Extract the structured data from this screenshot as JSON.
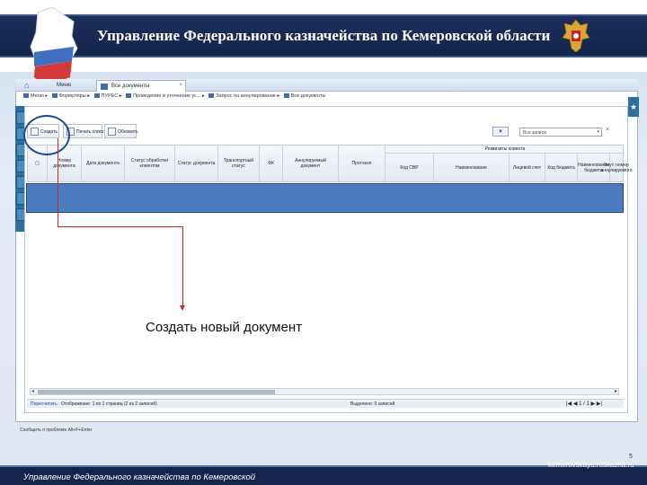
{
  "banner": {
    "title": "Управление Федерального казначейства по Кемеровской области"
  },
  "app": {
    "tabs": {
      "home_icon": "home-icon",
      "menu": "Меню",
      "active": "Все документы",
      "close": "×"
    },
    "breadcrumbs": [
      "Меню",
      "Формуляры",
      "ПУРЕС",
      "Проведение и уточнение ус...",
      "Запрос на аннулирование",
      "Все документы"
    ],
    "toolbar": {
      "create": "Создать",
      "print_list": "Печать списка",
      "refresh": "Обновить"
    },
    "filter": {
      "select_value": "Все записи",
      "dropdown": "▾",
      "clear": "×"
    },
    "grid": {
      "group_header": "Реквизиты клиента",
      "columns": [
        "Номер документа",
        "Дата документа",
        "Статус обработки клиентом",
        "Статус документа",
        "Транспортный статус",
        "ФК",
        "Аннулируемый документ",
        "Протокол"
      ],
      "sub_columns": [
        "Код СВР",
        "Наименование",
        "Лицевой счет",
        "Код бюджета",
        "Наименование бюджета",
        "Внут. номер аннулируемого"
      ]
    },
    "statusbar": {
      "recalc": "Пересчитать",
      "display": "Отображение: 1 по 1 страниц (2 из 2 записей)",
      "selected": "Выделено: 0 записей",
      "pager": "|◀ ◀ 1 / 1 ▶ ▶|"
    },
    "bottom_link": "Сообщить о проблеме Alt+F+Enter",
    "rail_right": "★"
  },
  "annotation": {
    "text": "Создать новый документ"
  },
  "footer": {
    "left": "Управление Федерального казначейства по Кемеровской",
    "right": "kemerovskaya.roskazna.ru",
    "page": "5"
  },
  "colors": {
    "banner": "#13254b",
    "selection": "#4a7cbf",
    "arrow": "#d2232a"
  }
}
